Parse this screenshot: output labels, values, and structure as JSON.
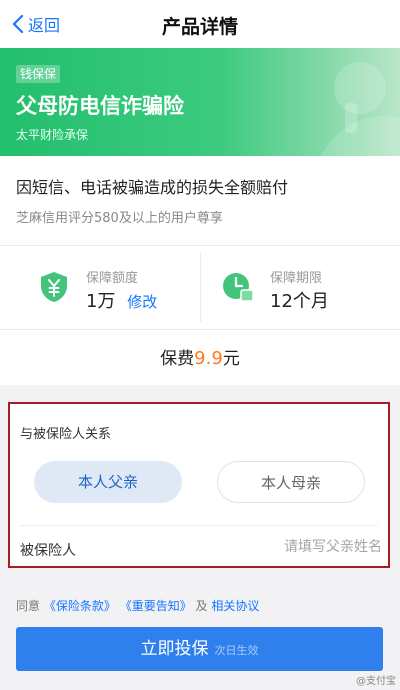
{
  "nav": {
    "back_label": "返回",
    "title": "产品详情"
  },
  "banner": {
    "tag": "钱保保",
    "title": "父母防电信诈骗险",
    "subtitle": "太平财险承保"
  },
  "product": {
    "headline": "因短信、电话被骗造成的损失全额赔付",
    "eligibility": "芝麻信用评分580及以上的用户尊享"
  },
  "coverage": {
    "amount_label": "保障额度",
    "amount_value": "1万",
    "amount_edit": "修改",
    "period_label": "保障期限",
    "period_value": "12个月"
  },
  "premium": {
    "prefix": "保费",
    "amount": "9.9",
    "unit": "元"
  },
  "form": {
    "relation_label": "与被保险人关系",
    "options": [
      {
        "label": "本人父亲",
        "selected": true
      },
      {
        "label": "本人母亲",
        "selected": false
      }
    ],
    "insured_label": "被保险人",
    "insured_placeholder": "请填写父亲姓名",
    "insured_value": ""
  },
  "agreement": {
    "prefix": "同意",
    "terms": "《保险条款》",
    "notice": "《重要告知》",
    "and": "及",
    "protocol": "相关协议"
  },
  "cta": {
    "label": "立即投保",
    "hint": "次日生效"
  },
  "watermark": "@支付宝",
  "colors": {
    "brand_blue": "#1677ff",
    "banner_green": "#23bf6d",
    "price_orange": "#ff7a1a",
    "highlight_border": "#a81c20"
  },
  "icons": {
    "back": "chevron-left-icon",
    "coverage": "shield-yen-icon",
    "period": "clock-calendar-icon"
  }
}
